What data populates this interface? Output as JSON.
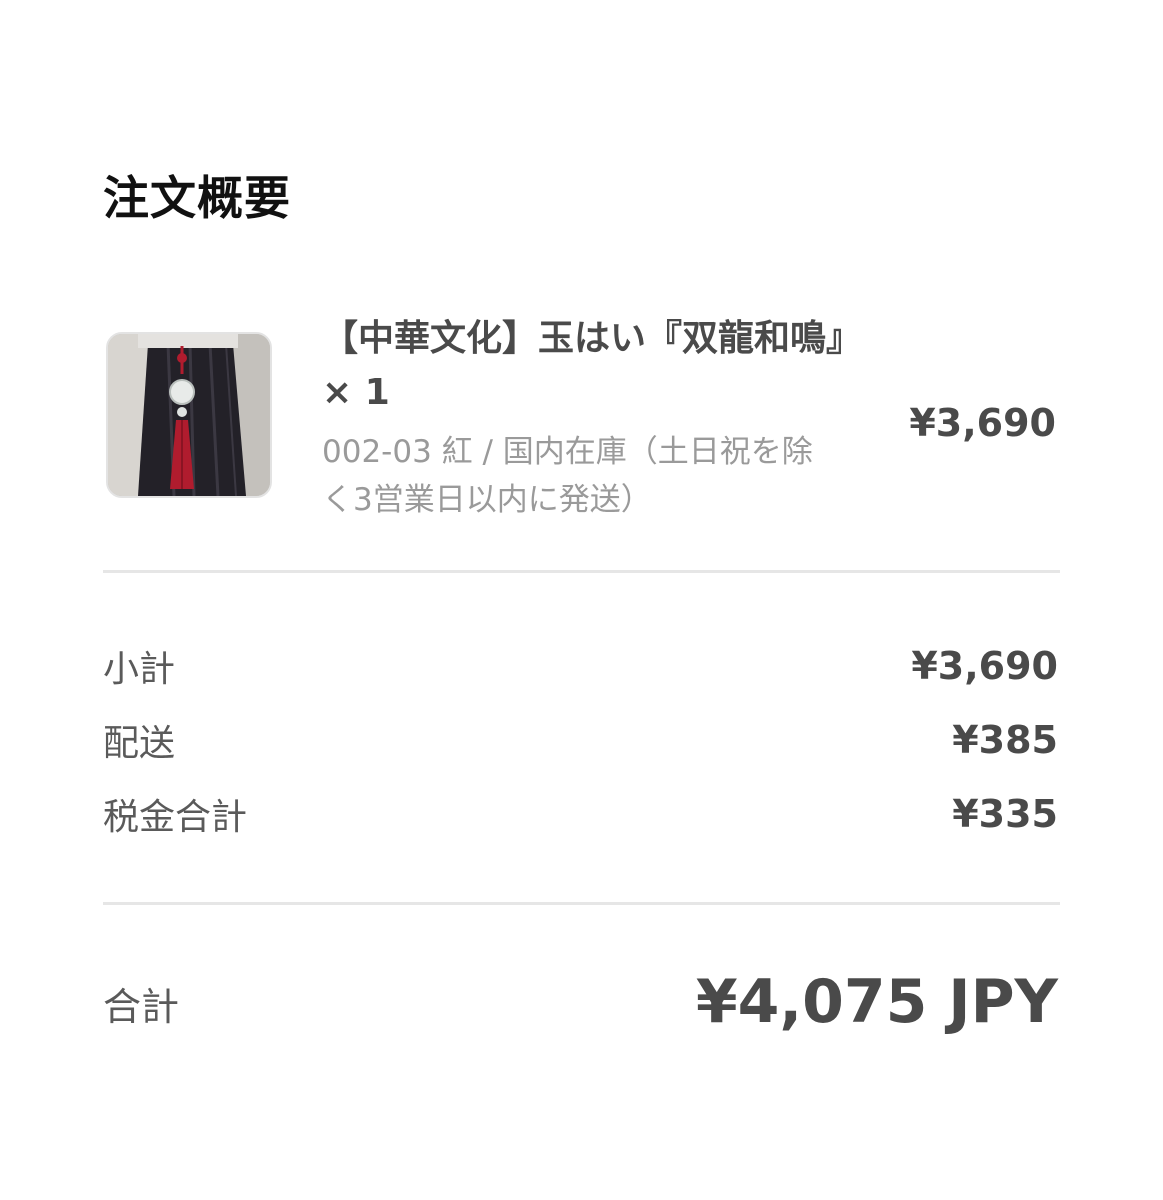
{
  "summary": {
    "title": "注文概要"
  },
  "item": {
    "name": "【中華文化】玉はい『双龍和鳴』 × 1",
    "variant": "002-03 紅 / 国内在庫（土日祝を除く3営業日以内に発送）",
    "price": "¥3,690",
    "image_icon": "product-photo"
  },
  "breakdown": [
    {
      "label": "小計",
      "value": "¥3,690"
    },
    {
      "label": "配送",
      "value": "¥385"
    },
    {
      "label": "税金合計",
      "value": "¥335"
    }
  ],
  "total": {
    "label": "合計",
    "value": "¥4,075 JPY"
  },
  "colors": {
    "background": "#ffffff",
    "divider": "#e6e6e6",
    "title": "#111111",
    "price": "#4a4a4a",
    "muted": "#9a9a9a",
    "tassel": "#b01c2e"
  }
}
